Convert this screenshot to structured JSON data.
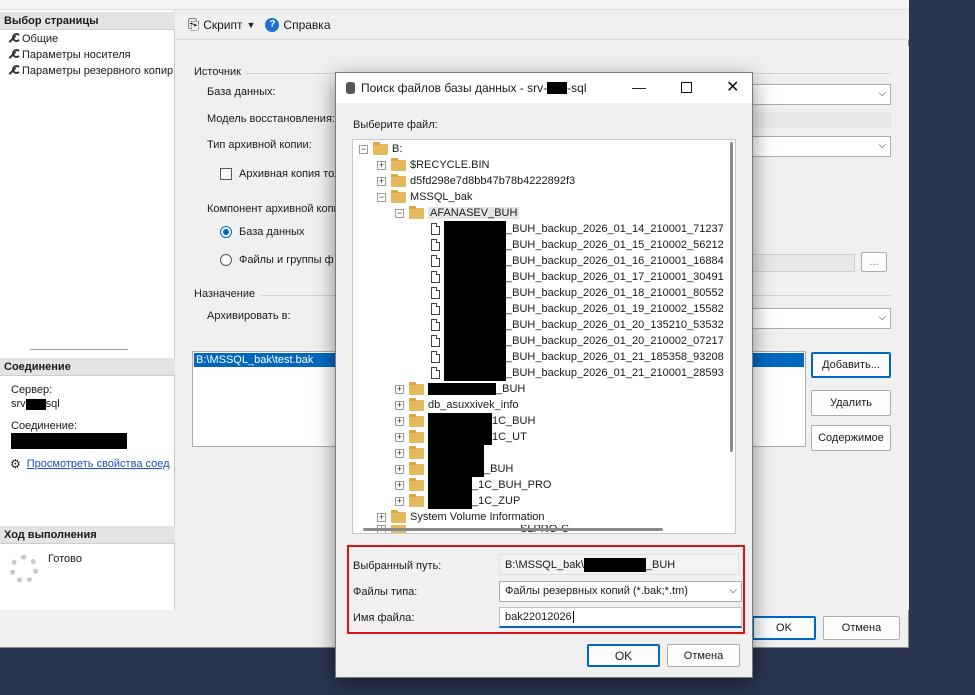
{
  "main_window": {
    "left_panel": {
      "select_page_header": "Выбор страницы",
      "pages": [
        "Общие",
        "Параметры носителя",
        "Параметры резервного копир"
      ],
      "connection_header": "Соединение",
      "server_label": "Сервер:",
      "server_value_prefix": "srv",
      "server_value_suffix": "sql",
      "connection_label": "Соединение:",
      "view_properties_link": "Просмотреть свойства соед",
      "progress_header": "Ход выполнения",
      "progress_status": "Готово"
    },
    "toolbar": {
      "script_label": "Скрипт",
      "help_label": "Справка"
    },
    "form": {
      "source_label": "Источник",
      "database_label": "База данных:",
      "recovery_model_label": "Модель восстановления:",
      "backup_type_label": "Тип архивной копии:",
      "copy_only_label": "Архивная копия тол",
      "component_label": "Компонент архивной копи",
      "radio_database": "База данных",
      "radio_files": "Файлы и группы ф",
      "destination_label": "Назначение",
      "backup_to_label": "Архивировать в:",
      "destination_path": "B:\\MSSQL_bak\\test.bak",
      "browse_button": "...",
      "add_button": "Добавить...",
      "remove_button": "Удалить",
      "contents_button": "Содержимое",
      "ok_button": "OK",
      "cancel_button": "Отмена"
    }
  },
  "dialog": {
    "title_prefix": "Поиск файлов базы данных - srv-",
    "title_suffix": "-sql",
    "select_file_label": "Выберите файл:",
    "tree": {
      "root": "B:",
      "recycle_bin": "$RECYCLE.BIN",
      "guid_folder": "d5fd298e7d8bb47b78b4222892f3",
      "mssql_bak": "MSSQL_bak",
      "afanasev": "AFANASEV_BUH",
      "files": [
        "_BUH_backup_2026_01_14_210001_71237",
        "_BUH_backup_2026_01_15_210002_56212",
        "_BUH_backup_2026_01_16_210001_16884",
        "_BUH_backup_2026_01_17_210001_30491",
        "_BUH_backup_2026_01_18_210001_80552",
        "_BUH_backup_2026_01_19_210002_15582",
        "_BUH_backup_2026_01_20_135210_53532",
        "_BUH_backup_2026_01_20_210002_07217",
        "_BUH_backup_2026_01_21_185358_93208",
        "_BUH_backup_2026_01_21_210001_28593"
      ],
      "folders_after": [
        "_BUH",
        "db_asuxxivek_info",
        "1C_BUH",
        "1C_UT",
        "",
        "_BUH",
        "_1C_BUH_PRO",
        "_1C_ZUP"
      ],
      "system_volume": "System Volume Information",
      "partial_last": "SLPRO-C"
    },
    "selected_path_label": "Выбранный путь:",
    "selected_path_prefix": "B:\\MSSQL_bak\\",
    "selected_path_suffix": "_BUH",
    "files_of_type_label": "Файлы типа:",
    "files_of_type_value": "Файлы резервных копий (*.bak;*.tm)",
    "file_name_label": "Имя файла:",
    "file_name_value": "bak22012026",
    "ok_button": "OK",
    "cancel_button": "Отмена"
  },
  "colors": {
    "desktop": "#2b3550",
    "highlight": "#0067c0",
    "red_outline": "#e01010"
  }
}
